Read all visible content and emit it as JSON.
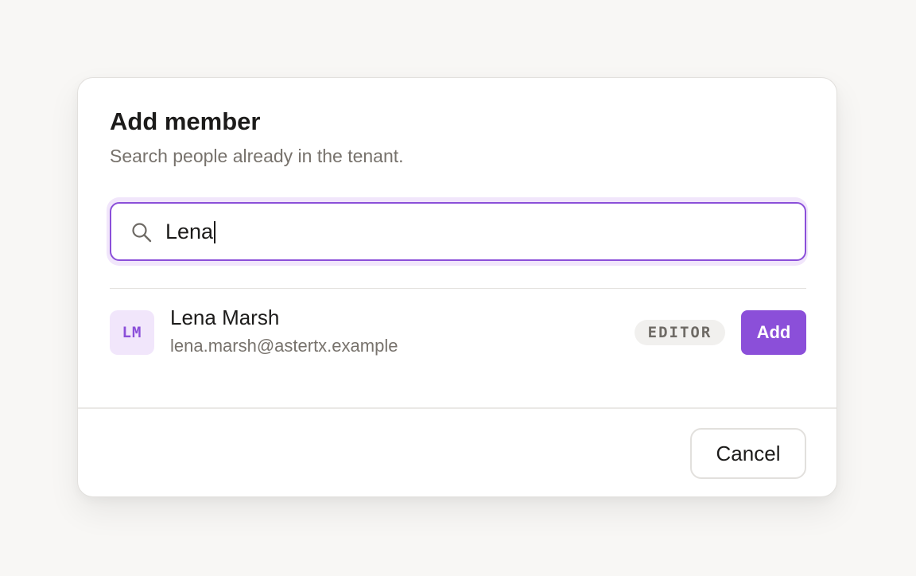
{
  "dialog": {
    "title": "Add member",
    "subtitle": "Search people already in the tenant."
  },
  "search": {
    "value": "Lena",
    "icon": "search-icon"
  },
  "result": {
    "initials": "LM",
    "name": "Lena Marsh",
    "email": "lena.marsh@astertx.example",
    "role": "EDITOR",
    "add_label": "Add"
  },
  "footer": {
    "cancel_label": "Cancel"
  },
  "colors": {
    "accent": "#8b4fd9",
    "accent_soft": "#f1e6fb",
    "background": "#f8f7f5"
  }
}
